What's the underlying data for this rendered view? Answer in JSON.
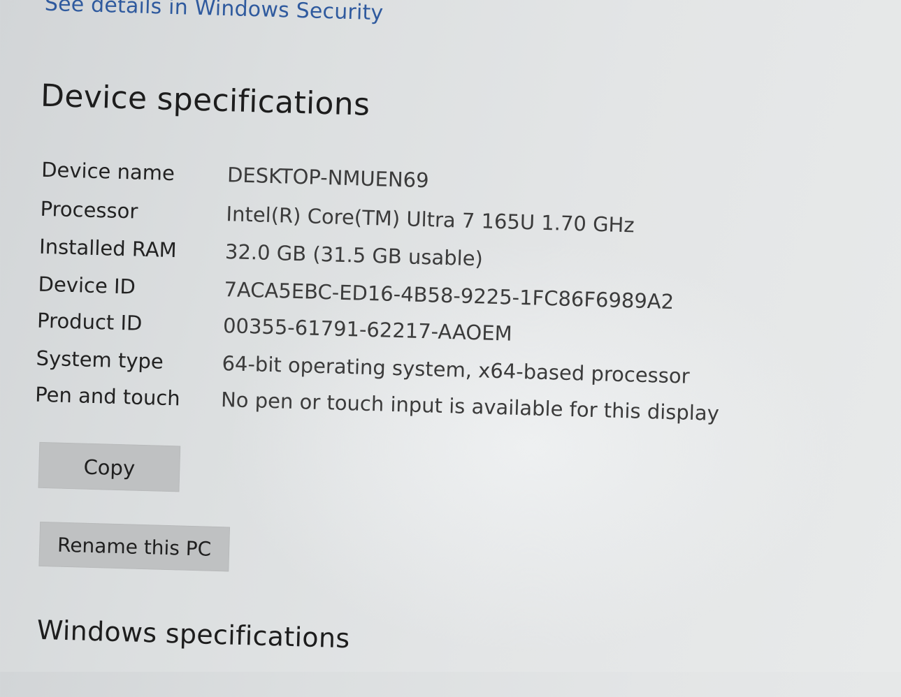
{
  "top_link": "See details in Windows Security",
  "device_specs": {
    "title": "Device specifications",
    "rows": [
      {
        "label": "Device name",
        "value": "DESKTOP-NMUEN69"
      },
      {
        "label": "Processor",
        "value": "Intel(R) Core(TM) Ultra 7 165U   1.70 GHz"
      },
      {
        "label": "Installed RAM",
        "value": "32.0 GB (31.5 GB usable)"
      },
      {
        "label": "Device ID",
        "value": "7ACA5EBC-ED16-4B58-9225-1FC86F6989A2"
      },
      {
        "label": "Product ID",
        "value": "00355-61791-62217-AAOEM"
      },
      {
        "label": "System type",
        "value": "64-bit operating system, x64-based processor"
      },
      {
        "label": "Pen and touch",
        "value": "No pen or touch input is available for this display"
      }
    ],
    "copy_label": "Copy",
    "rename_label": "Rename this PC"
  },
  "windows_specs": {
    "title": "Windows specifications"
  },
  "colors": {
    "link": "#2f5a9e",
    "button_bg": "#bfc1c2"
  }
}
